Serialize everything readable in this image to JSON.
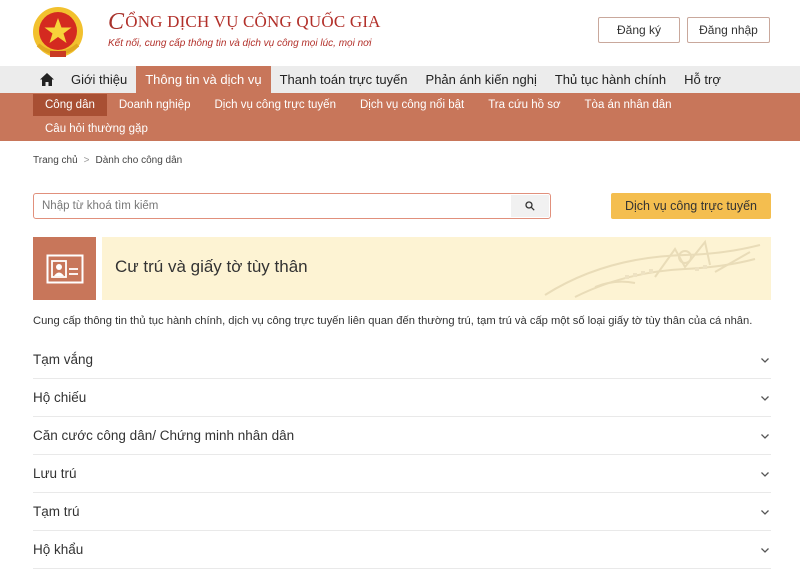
{
  "header": {
    "brand_c": "C",
    "brand_title": "ỔNG DỊCH VỤ CÔNG QUỐC GIA",
    "brand_subtitle": "Kết nối, cung cấp thông tin và dịch vụ công mọi lúc, mọi nơi",
    "register_label": "Đăng ký",
    "login_label": "Đăng nhập",
    "emblem_icon": "national-emblem-icon"
  },
  "mainnav": {
    "home_icon": "home-icon",
    "items": [
      {
        "label": "Giới thiệu"
      },
      {
        "label": "Thông tin và dịch vụ"
      },
      {
        "label": "Thanh toán trực tuyến"
      },
      {
        "label": "Phản ánh kiến nghị"
      },
      {
        "label": "Thủ tục hành chính"
      },
      {
        "label": "Hỗ trợ"
      }
    ],
    "active_index": 1
  },
  "subnav": {
    "items": [
      {
        "label": "Công dân"
      },
      {
        "label": "Doanh nghiệp"
      },
      {
        "label": "Dịch vụ công trực tuyến"
      },
      {
        "label": "Dịch vụ công nổi bật"
      },
      {
        "label": "Tra cứu hồ sơ"
      },
      {
        "label": "Tòa án nhân dân"
      },
      {
        "label": "Câu hỏi thường gặp"
      }
    ],
    "active_index": 0
  },
  "breadcrumb": {
    "home": "Trang chủ",
    "separator": ">",
    "current": "Dành cho công dân"
  },
  "search": {
    "placeholder": "Nhập từ khoá tìm kiếm",
    "value": "",
    "icon": "search-icon"
  },
  "online_service_label": "Dịch vụ công trực tuyến",
  "topic": {
    "icon": "id-card-icon",
    "title": "Cư trú và giấy tờ tùy thân",
    "description": "Cung cấp thông tin thủ tục hành chính, dịch vụ công trực tuyến liên quan đến thường trú, tạm trú và cấp một số loại giấy tờ tùy thân của cá nhân."
  },
  "accordion": {
    "items": [
      {
        "label": "Tạm vắng"
      },
      {
        "label": "Hộ chiếu"
      },
      {
        "label": "Căn cước công dân/ Chứng minh nhân dân"
      },
      {
        "label": "Lưu trú"
      },
      {
        "label": "Tạm trú"
      },
      {
        "label": "Hộ khẩu"
      }
    ],
    "chevron_icon": "chevron-down-icon"
  },
  "colors": {
    "brand_red": "#b2302a",
    "accent_terracotta": "#c8765a",
    "active_sub": "#a84f33",
    "nav_bg": "#ececec",
    "button_yellow": "#f4be4f",
    "banner_bg": "#fdf3d3"
  }
}
